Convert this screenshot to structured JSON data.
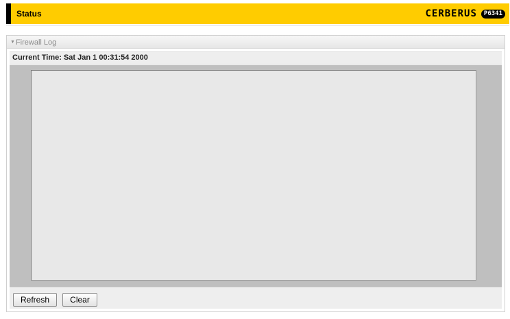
{
  "header": {
    "title": "Status",
    "brand_name": "CERBERUS",
    "brand_model": "P6341",
    "accent_color": "#ffcc00"
  },
  "panel": {
    "title": "Firewall Log",
    "collapse_icon": "triangle-down-icon",
    "current_time_label": "Current Time: Sat Jan 1 00:31:54 2000",
    "log_content": "",
    "buttons": {
      "refresh": "Refresh",
      "clear": "Clear"
    }
  }
}
